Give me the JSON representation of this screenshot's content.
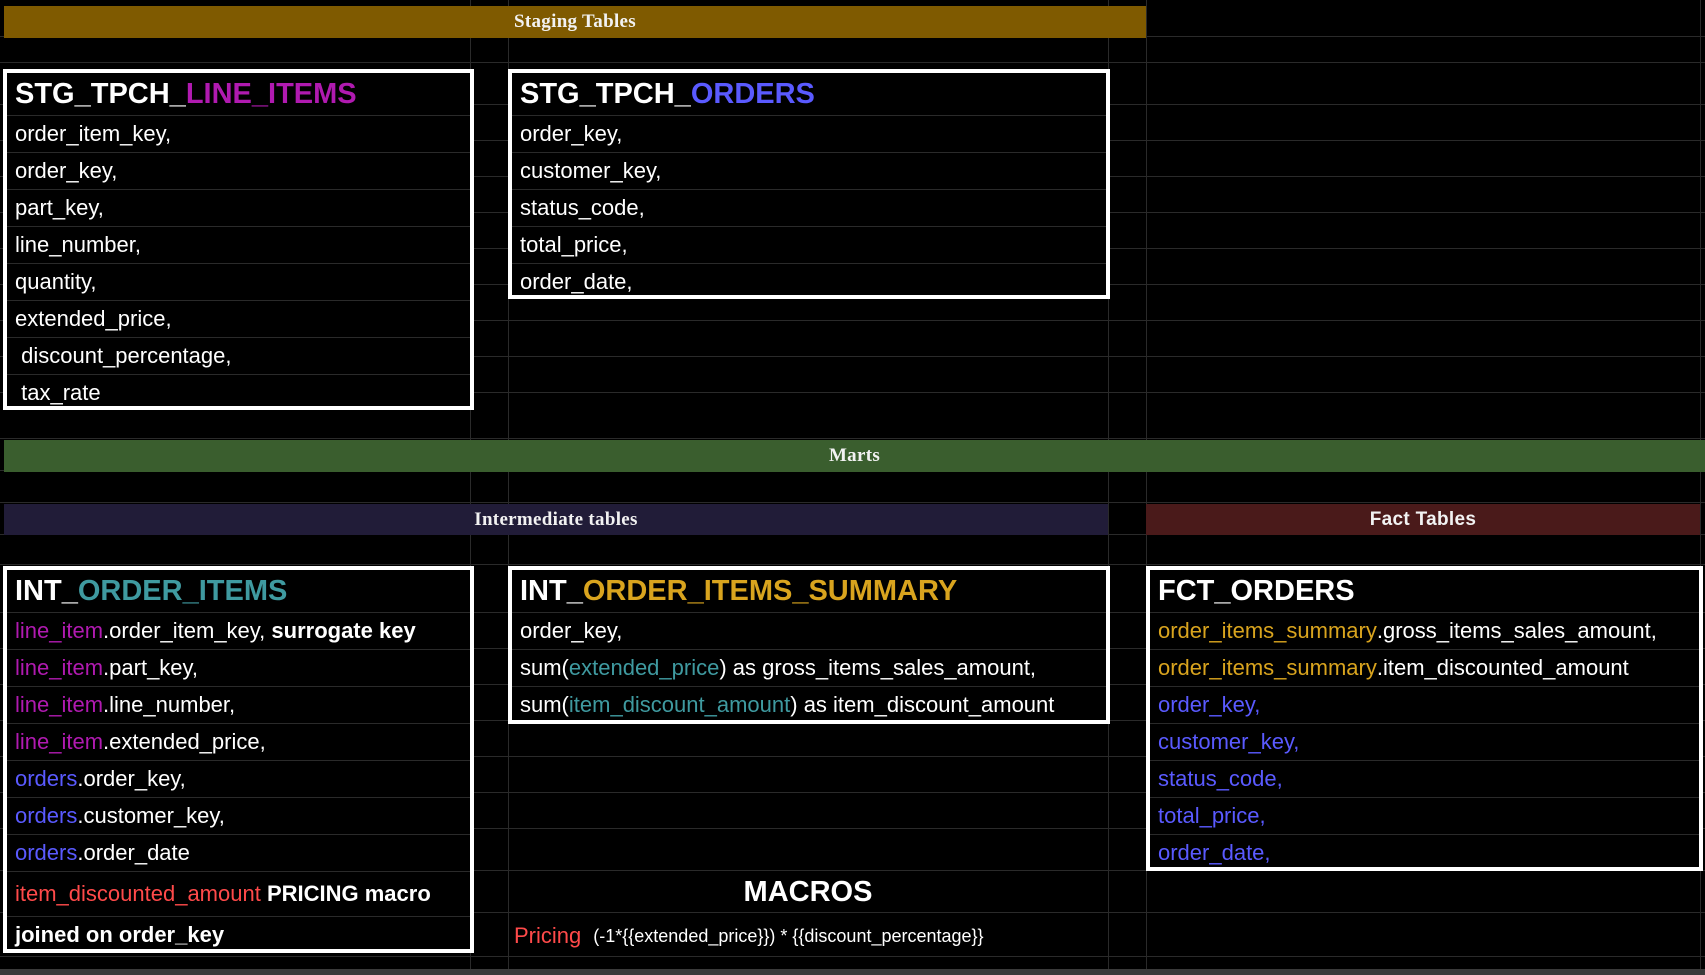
{
  "colors": {
    "staging_banner": "#7f5a00",
    "marts_banner": "#3a5e2e",
    "intermediate_banner": "#211c38",
    "fact_banner": "#4a1a1a",
    "magenta": "#b01ab0",
    "blue": "#5a5aff",
    "teal": "#3f9aa0",
    "gold": "#d9a41e",
    "red": "#ff4a4a",
    "white": "#ffffff"
  },
  "banners": {
    "staging": "Staging Tables",
    "marts": "Marts",
    "intermediate": "Intermediate tables",
    "fact": "Fact Tables"
  },
  "stg_line_items": {
    "title_prefix": "STG_TPCH_",
    "title_suffix": "LINE_ITEMS",
    "rows": [
      "order_item_key,",
      "order_key,",
      "part_key,",
      "line_number,",
      "quantity,",
      "extended_price,",
      " discount_percentage,",
      " tax_rate"
    ]
  },
  "stg_orders": {
    "title_prefix": "STG_TPCH_",
    "title_suffix": "ORDERS",
    "rows": [
      "order_key,",
      "customer_key,",
      "status_code,",
      "total_price,",
      "order_date,"
    ]
  },
  "int_order_items": {
    "title_prefix": "INT_",
    "title_suffix": "ORDER_ITEMS",
    "rows": [
      {
        "prefix": "line_item",
        "rest": ".order_item_key, ",
        "bold": "surrogate key"
      },
      {
        "prefix": "line_item",
        "rest": ".part_key,"
      },
      {
        "prefix": "line_item",
        "rest": ".line_number,"
      },
      {
        "prefix": "line_item",
        "rest": ".extended_price,"
      },
      {
        "prefix": "orders",
        "rest": ".order_key,"
      },
      {
        "prefix": "orders",
        "rest": ".customer_key,"
      },
      {
        "prefix": "orders",
        "rest": ".order_date"
      },
      {
        "prefix": "item_discounted_amount",
        "bold": " PRICING macro"
      },
      {
        "bold": "joined on order_key"
      }
    ]
  },
  "int_order_items_summary": {
    "title_prefix": "INT_",
    "title_suffix": "ORDER_ITEMS_SUMMARY",
    "row1": "order_key,",
    "row2_a": "sum(",
    "row2_b": "extended_price",
    "row2_c": ") as gross_items_sales_amount,",
    "row3_a": "sum(",
    "row3_b": "item_discount_amount",
    "row3_c": ") as item_discount_amount"
  },
  "fct_orders": {
    "title": "FCT_ORDERS",
    "summary_rows": [
      {
        "prefix": "order_items_summary",
        "rest": ".gross_items_sales_amount,"
      },
      {
        "prefix": "order_items_summary",
        "rest": ".item_discounted_amount"
      }
    ],
    "order_rows": [
      "order_key,",
      "customer_key,",
      "status_code,",
      "total_price,",
      "order_date,"
    ]
  },
  "macros": {
    "title": "MACROS",
    "name": "Pricing",
    "expression": "(-1*{{extended_price}}) * {{discount_percentage}}"
  }
}
